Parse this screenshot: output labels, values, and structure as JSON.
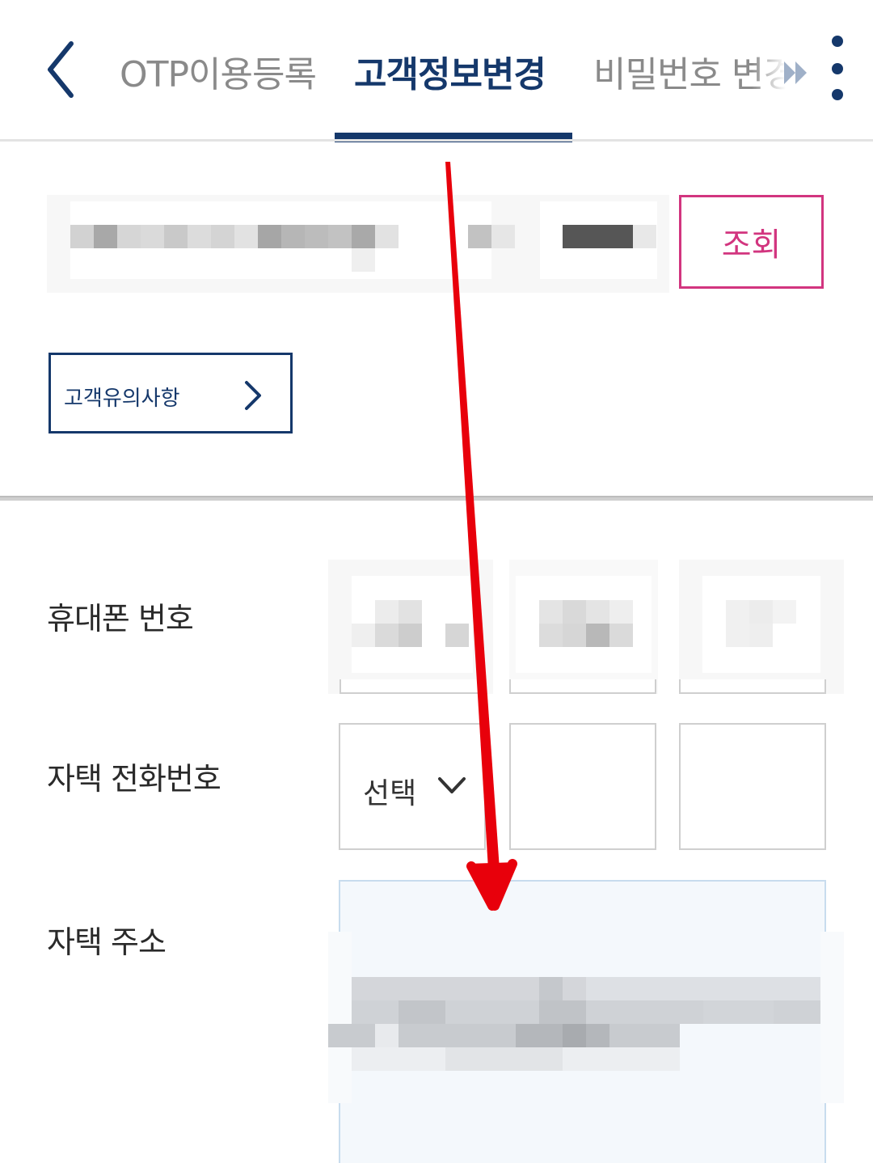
{
  "header": {
    "tabs": [
      {
        "label": "OTP이용등록",
        "active": false
      },
      {
        "label": "고객정보변경",
        "active": true
      },
      {
        "label": "비밀번호 변경",
        "active": false
      }
    ],
    "icons": {
      "back": "chevron-left-icon",
      "scroll": "double-chevron-right-icon",
      "more": "vertical-dots-icon"
    }
  },
  "lookup": {
    "button_label": "조회",
    "notice_button_label": "고객유의사항",
    "notice_icon": "chevron-right-icon"
  },
  "form": {
    "mobile_label": "휴대폰 번호",
    "home_phone_label": "자택 전화번호",
    "home_phone_select": "선택",
    "home_address_label": "자택 주소"
  },
  "annotation": {
    "type": "red-arrow",
    "direction": "down",
    "color": "#e8000b"
  },
  "colors": {
    "brand_navy": "#15386b",
    "lookup_pink": "#d2357f",
    "address_bg": "#f4f8fc"
  }
}
